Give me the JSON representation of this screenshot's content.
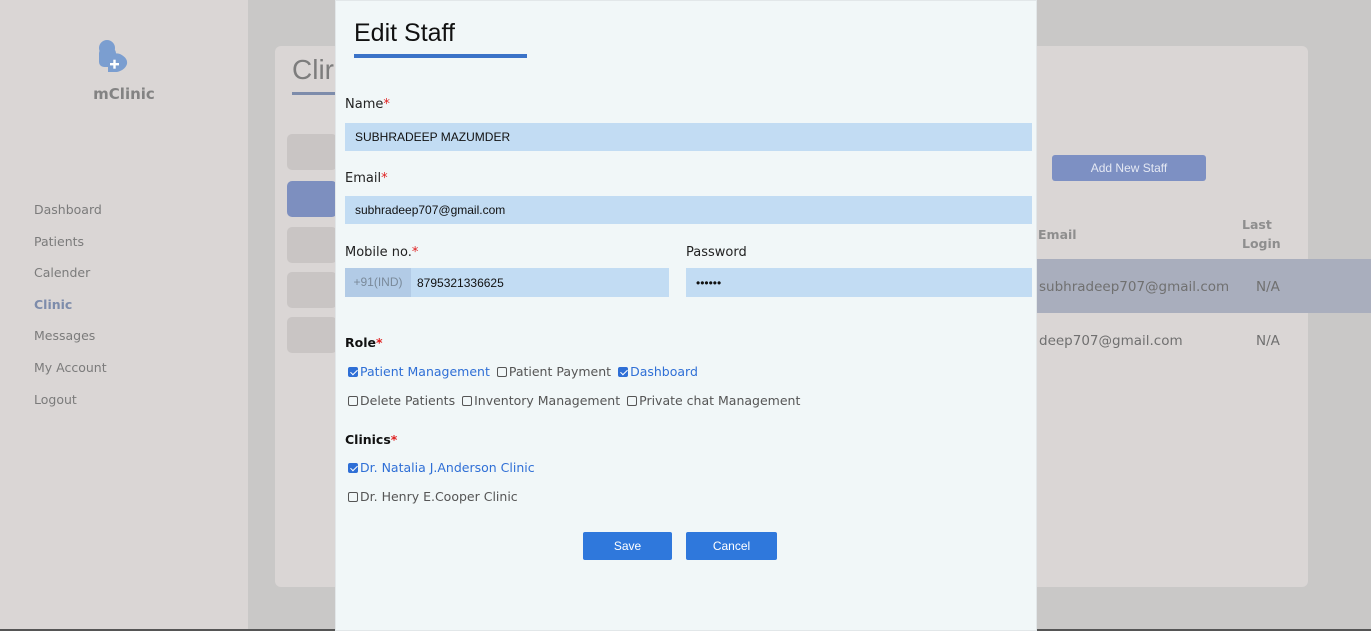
{
  "sidebar": {
    "brand": "mClinic",
    "items": [
      {
        "label": "Dashboard"
      },
      {
        "label": "Patients"
      },
      {
        "label": "Calender"
      },
      {
        "label": "Clinic",
        "active": true
      },
      {
        "label": "Messages"
      },
      {
        "label": "My Account"
      },
      {
        "label": "Logout"
      }
    ]
  },
  "background": {
    "page_title": "Clir",
    "add_button": "Add New Staff",
    "table": {
      "headers": {
        "email": "Email",
        "last_login": "Last Login"
      },
      "rows": [
        {
          "email": "subhradeep707@gmail.com",
          "last_login": "N/A"
        },
        {
          "email": "deep707@gmail.com",
          "last_login": "N/A"
        }
      ]
    }
  },
  "modal": {
    "title": "Edit Staff",
    "name": {
      "label": "Name",
      "required_mark": "*",
      "value": "SUBHRADEEP MAZUMDER"
    },
    "email": {
      "label": "Email",
      "required_mark": "*",
      "value": "subhradeep707@gmail.com"
    },
    "mobile": {
      "label": "Mobile no.",
      "required_mark": "*",
      "prefix": "+91(IND)",
      "value": "8795321336625"
    },
    "password": {
      "label": "Password",
      "value": "123456"
    },
    "role": {
      "label": "Role",
      "required_mark": "*",
      "options": [
        {
          "label": "Patient Management",
          "checked": true
        },
        {
          "label": "Patient Payment",
          "checked": false
        },
        {
          "label": "Dashboard",
          "checked": true
        },
        {
          "label": "Delete Patients",
          "checked": false
        },
        {
          "label": "Inventory Management",
          "checked": false
        },
        {
          "label": "Private chat Management",
          "checked": false
        }
      ]
    },
    "clinics": {
      "label": "Clinics",
      "required_mark": "*",
      "options": [
        {
          "label": "Dr. Natalia J.Anderson Clinic",
          "checked": true
        },
        {
          "label": "Dr. Henry E.Cooper Clinic",
          "checked": false
        }
      ]
    },
    "save_label": "Save",
    "cancel_label": "Cancel"
  },
  "colors": {
    "accent": "#2f78dc",
    "input_bg": "#c2dcf3",
    "required": "#e02020"
  }
}
